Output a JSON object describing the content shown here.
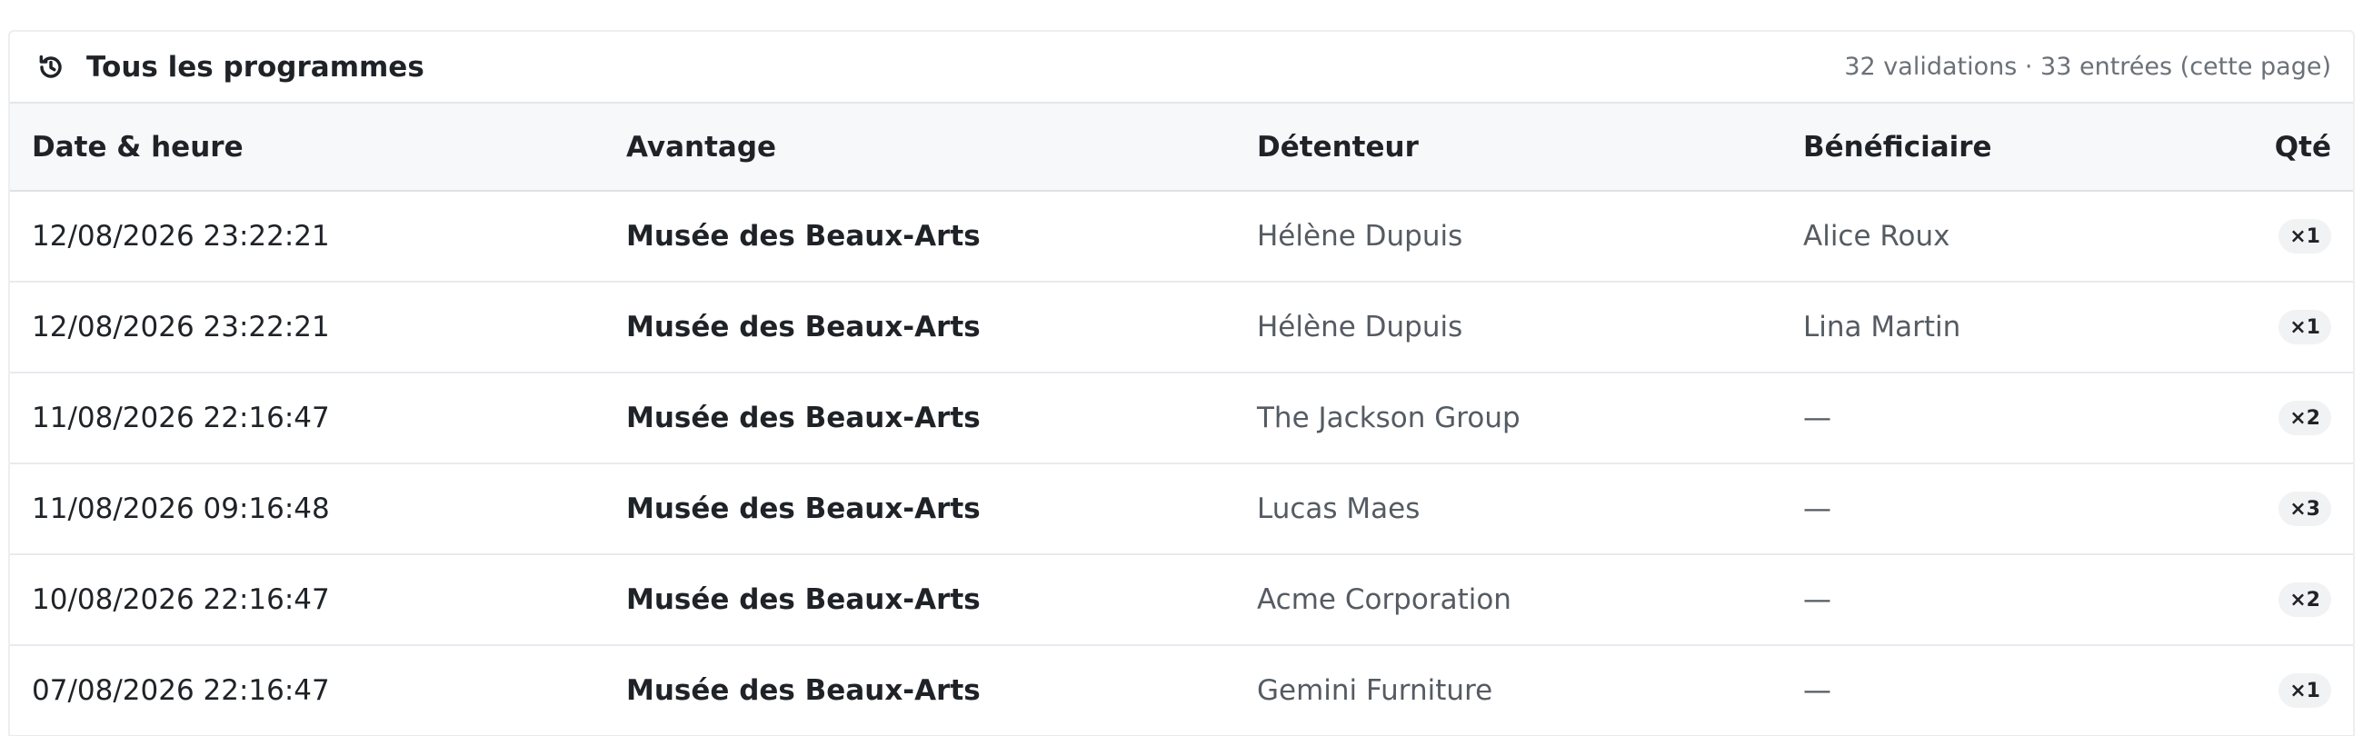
{
  "header": {
    "icon": "history-icon",
    "title": "Tous les programmes",
    "summary": "32 validations · 33 entrées (cette page)"
  },
  "columns": {
    "date": "Date & heure",
    "benefit": "Avantage",
    "holder": "Détenteur",
    "beneficiary": "Bénéficiaire",
    "qty": "Qté"
  },
  "rows": [
    {
      "date": "12/08/2026 23:22:21",
      "benefit": "Musée des Beaux-Arts",
      "holder": "Hélène Dupuis",
      "beneficiary": "Alice Roux",
      "qty": "×1"
    },
    {
      "date": "12/08/2026 23:22:21",
      "benefit": "Musée des Beaux-Arts",
      "holder": "Hélène Dupuis",
      "beneficiary": "Lina Martin",
      "qty": "×1"
    },
    {
      "date": "11/08/2026 22:16:47",
      "benefit": "Musée des Beaux-Arts",
      "holder": "The Jackson Group",
      "beneficiary": "—",
      "qty": "×2"
    },
    {
      "date": "11/08/2026 09:16:48",
      "benefit": "Musée des Beaux-Arts",
      "holder": "Lucas Maes",
      "beneficiary": "—",
      "qty": "×3"
    },
    {
      "date": "10/08/2026 22:16:47",
      "benefit": "Musée des Beaux-Arts",
      "holder": "Acme Corporation",
      "beneficiary": "—",
      "qty": "×2"
    },
    {
      "date": "07/08/2026 22:16:47",
      "benefit": "Musée des Beaux-Arts",
      "holder": "Gemini Furniture",
      "beneficiary": "—",
      "qty": "×1"
    }
  ],
  "colors": {
    "header_bg": "#f7f8f9",
    "border": "#e3e6e9",
    "muted_text": "#6b7178",
    "badge_bg": "#f0f2f4"
  }
}
